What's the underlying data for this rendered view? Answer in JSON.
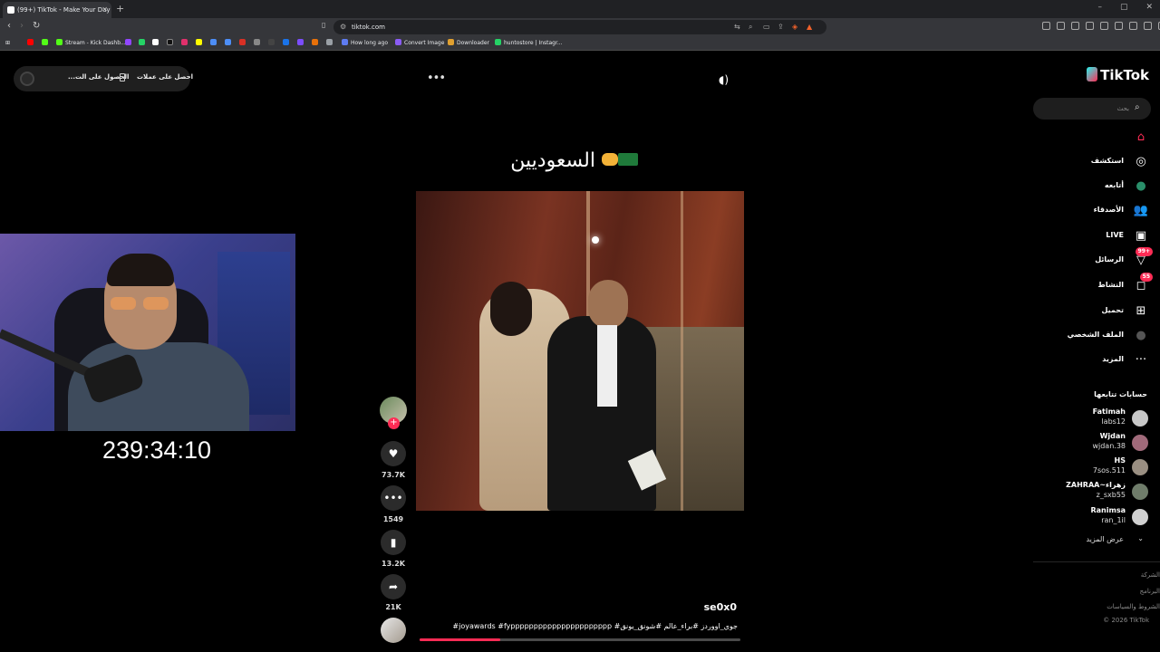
{
  "browser": {
    "tab_title": "(99+) TikTok - Make Your Day",
    "url": "tiktok.com",
    "bookmarks": [
      "Stream - Kick Dashb...",
      "How long ago",
      "Convert Image",
      "Downloader",
      "huntostore | Instagr..."
    ],
    "notification_count": "1"
  },
  "header": {
    "get_coins": "احصل على عملات",
    "get_app": "الحصول على الت..."
  },
  "stream": {
    "timer": "239:34:10"
  },
  "video": {
    "caption": "السعوديين",
    "author": "se0x0",
    "hashtags": "#joyawards #fypppppppppppppppppppppp #جوي_اووردز #براء_عالم #شونق_يونق",
    "progress": 0.25,
    "likes": "73.7K",
    "comments": "1549",
    "saves": "13.2K",
    "shares": "21K"
  },
  "sidebar": {
    "logo": "TikTok",
    "search_placeholder": "بحث",
    "nav": [
      {
        "label": "",
        "icon": "home-icon"
      },
      {
        "label": "استكشف",
        "icon": "compass-icon"
      },
      {
        "label": "أتابعه",
        "icon": "following-avatar-icon"
      },
      {
        "label": "الأصدقاء",
        "icon": "friends-icon"
      },
      {
        "label": "LIVE",
        "icon": "live-icon"
      },
      {
        "label": "الرسائل",
        "icon": "messages-icon",
        "badge": "99+"
      },
      {
        "label": "النشاط",
        "icon": "activity-icon",
        "badge": "55"
      },
      {
        "label": "تحميل",
        "icon": "upload-icon"
      },
      {
        "label": "الملف الشخصي",
        "icon": "profile-icon"
      },
      {
        "label": "المزيد",
        "icon": "more-icon"
      }
    ],
    "following_header": "حسابات تتابعها",
    "accounts": [
      {
        "name": "Fatimah",
        "handle": "labs12"
      },
      {
        "name": "Wjdan",
        "handle": "wjdan.38"
      },
      {
        "name": "HS",
        "handle": "7sos.511"
      },
      {
        "name": "ZAHRAA~زهراء",
        "handle": "z_sxb55"
      },
      {
        "name": "Ranimsa",
        "handle": "ran_1il"
      }
    ],
    "see_more": "عرض المزيد",
    "footer": [
      "الشركة",
      "البرنامج",
      "الشروط والسياسات"
    ],
    "copyright": "© 2026 TikTok"
  },
  "colors": {
    "accent": "#fe2c55",
    "background": "#000000",
    "chrome": "#35363a"
  }
}
